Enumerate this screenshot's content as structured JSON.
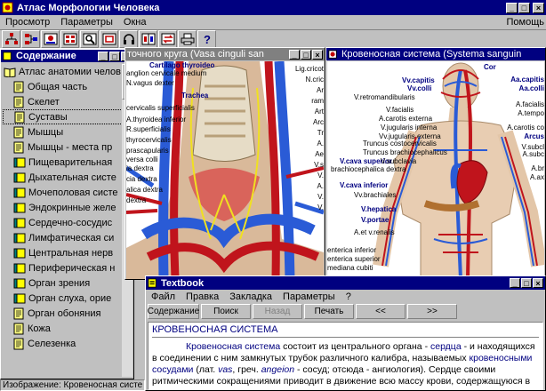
{
  "app": {
    "title": "Атлас Морфологии Человека"
  },
  "menu": {
    "items": [
      "Просмотр",
      "Параметры",
      "Окна"
    ],
    "help": "Помощь"
  },
  "toc": {
    "title": "Содержание",
    "root": "Атлас анатомии челов",
    "items": [
      {
        "label": "Общая часть",
        "kind": "doc"
      },
      {
        "label": "Скелет",
        "kind": "doc"
      },
      {
        "label": "Суставы",
        "kind": "doc",
        "selected": true
      },
      {
        "label": "Мышцы",
        "kind": "doc"
      },
      {
        "label": "Мышцы - места пр",
        "kind": "doc"
      },
      {
        "label": "Пищеварительная",
        "kind": "book"
      },
      {
        "label": "Дыхательная систе",
        "kind": "book"
      },
      {
        "label": "Мочеполовая систе",
        "kind": "book"
      },
      {
        "label": "Эндокринные желе",
        "kind": "book"
      },
      {
        "label": "Сердечно-сосудис",
        "kind": "book"
      },
      {
        "label": "Лимфатическая си",
        "kind": "book"
      },
      {
        "label": "Центральная нерв",
        "kind": "book"
      },
      {
        "label": "Периферическая н",
        "kind": "book"
      },
      {
        "label": "Орган зрения",
        "kind": "book"
      },
      {
        "label": "Орган слуха, орие",
        "kind": "book"
      },
      {
        "label": "Орган обоняния",
        "kind": "doc"
      },
      {
        "label": "Кожа",
        "kind": "doc"
      },
      {
        "label": "Селезенка",
        "kind": "doc"
      }
    ]
  },
  "status": {
    "text": "Изображение: Кровеносная систе"
  },
  "image_left": {
    "title": "точного круга (Vasa cinguli san",
    "labels_left": [
      "anglion cervicale medium",
      "N.vagus dexter",
      "cervicalis superficialis",
      "A.thyroidea inferior",
      "R.superficialis",
      "thyrocervicalis",
      "prascapularis",
      "versa colli",
      "ia dextra",
      "cia dextra",
      "alica dextra",
      "dextra"
    ],
    "labels_left_bold": [
      "Cartilago thyroideo",
      "Trachea"
    ],
    "labels_right": [
      "Lig.cricot",
      "N.cric",
      "Ar",
      "ram",
      "Art",
      "Arc",
      "Tr",
      "A.",
      "Ae",
      "V.s",
      "V.",
      "A.",
      "V.",
      "V."
    ]
  },
  "image_right": {
    "title": "Кровеносная система (Systema sanguin",
    "labels_left_bold": [
      "Vv.capitis",
      "Vv.colli",
      "V.cava superior",
      "V.cava inferior",
      "V.hepatica",
      "V.portae"
    ],
    "labels_left": [
      "V.retromandibularis",
      "V.facialis",
      "A.carotis externa",
      "V.jugularis interna",
      "Vv.jugularis externa",
      "Truncus costocervicalis",
      "Truncus brachiocephalicus",
      "V.subclavia",
      "brachiocephalica dextra",
      "Vv.brachiales",
      "A.et v.renalis",
      "enterica inferior",
      "enterica superior",
      "mediana cubiti"
    ],
    "labels_top": [
      "Cor"
    ],
    "labels_right_bold": [
      "Aa.capitis",
      "Aa.colli",
      "Arcus"
    ],
    "labels_right": [
      "A.facialis",
      "A.tempo",
      "A.carotis co",
      "V.subcl",
      "A.subc",
      "A.br",
      "A.ax"
    ]
  },
  "textbook": {
    "title": "Textbook",
    "menu": [
      "Файл",
      "Правка",
      "Закладка",
      "Параметры",
      "?"
    ],
    "buttons": [
      "Содержание",
      "Поиск",
      "Назад",
      "Печать",
      "<<",
      ">>"
    ],
    "heading": "КРОВЕНОСНАЯ СИСТЕМА",
    "p1": "Кровеносная система",
    "p2": " состоит из центрального органа - ",
    "p3": "сердца",
    "p4": " - и находящихся в соединении с ним замкнутых трубок различного калибра, называемых ",
    "p5": "кровеносными сосудами",
    "p6": " (лат. ",
    "p7": "vas",
    "p8": ", греч. ",
    "p9": "angeion",
    "p10": " - сосуд; отсюда - ангиология). Сердце своими ритмическими сокращениями приводит в движение всю массу крови, содержащуюся в сосудах."
  },
  "colors": {
    "title": "#000080",
    "face": "#c0c0c0",
    "link": "#000080",
    "heading": "#000080"
  }
}
